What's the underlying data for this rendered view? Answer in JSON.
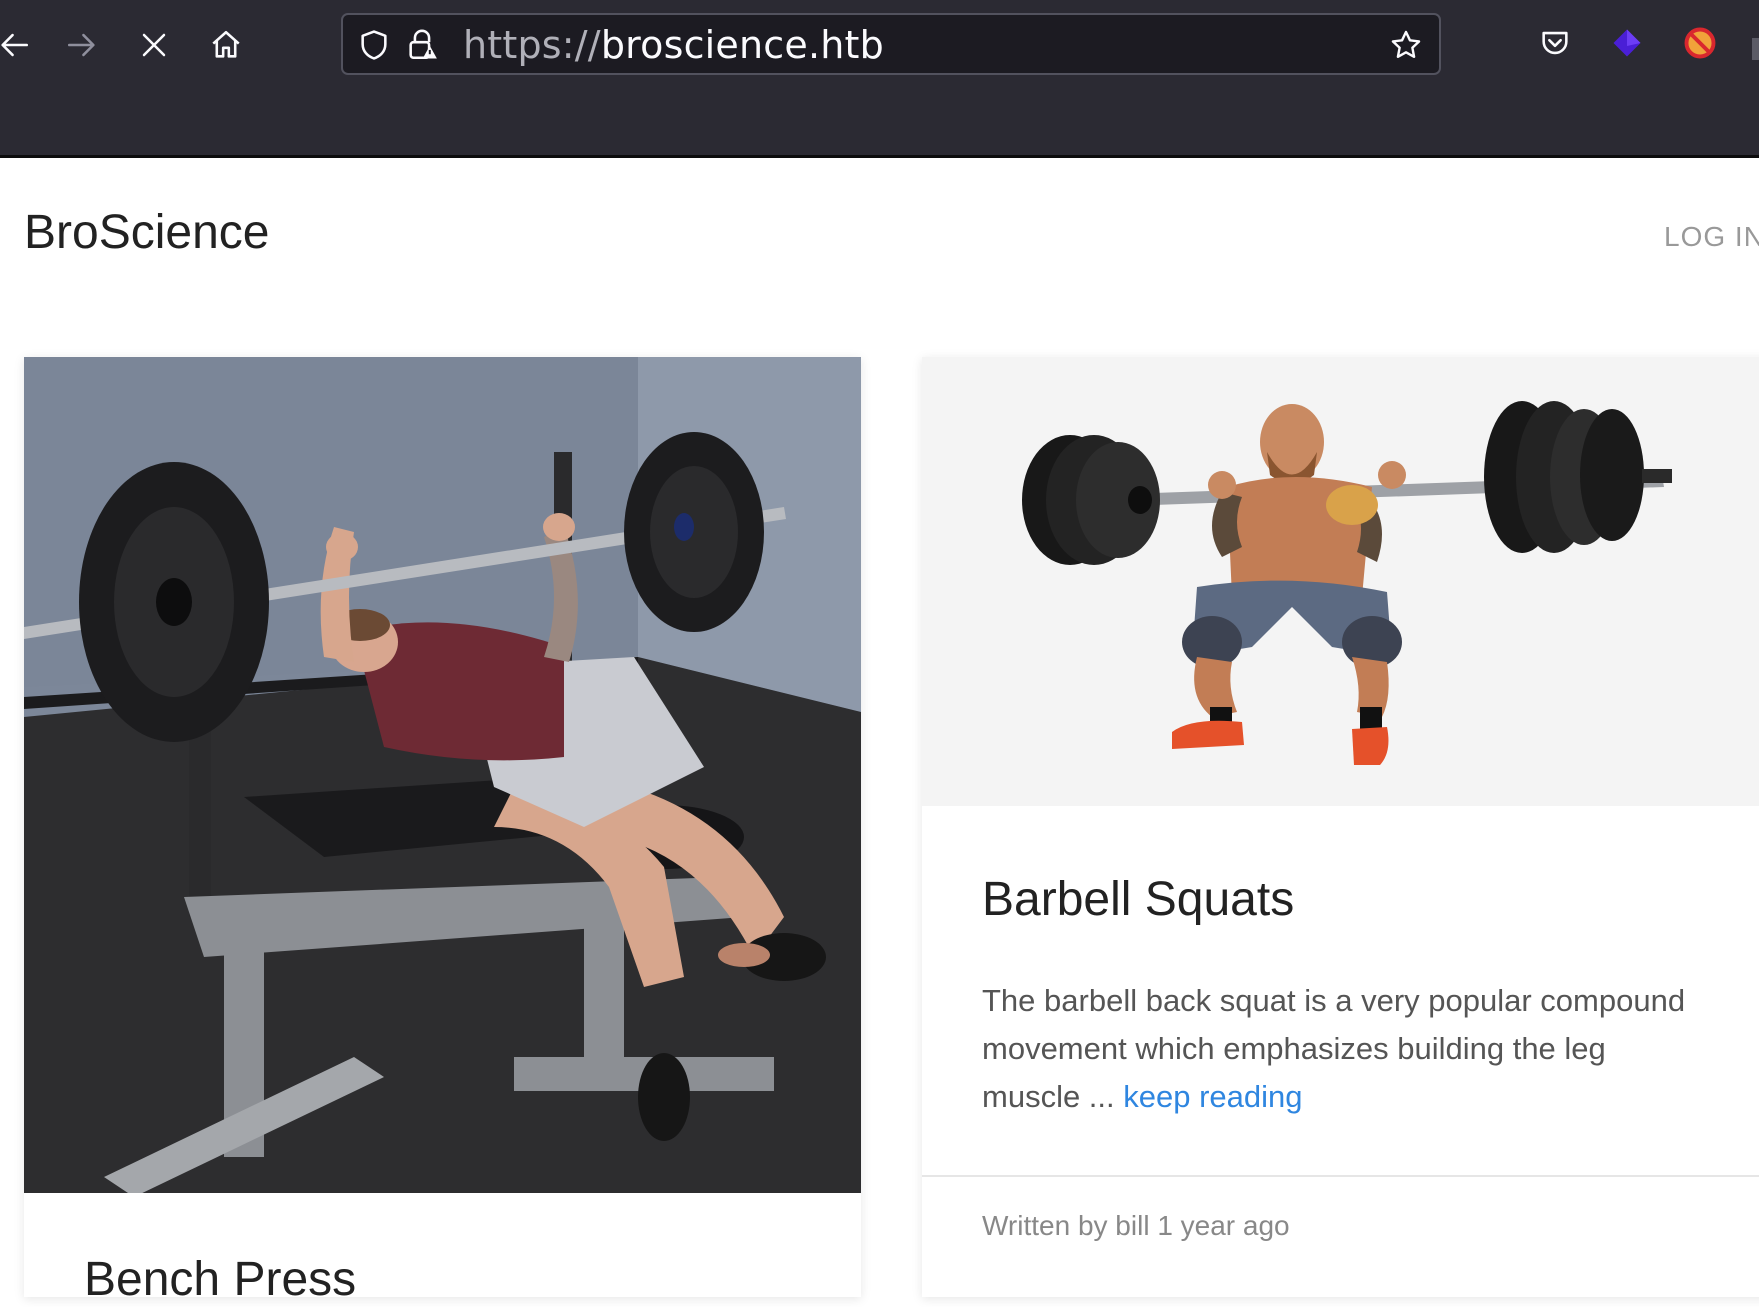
{
  "browser": {
    "url_protocol": "https://",
    "url_host": "broscience.htb",
    "icons": {
      "back": "arrow-left-icon",
      "forward": "arrow-right-icon",
      "stop": "close-icon",
      "home": "home-icon",
      "shield": "shield-icon",
      "lock": "lock-warning-icon",
      "bookmark": "star-icon",
      "pocket": "pocket-icon",
      "ext1": "purple-diamond-icon",
      "ext2": "blocked-extension-icon"
    }
  },
  "site": {
    "brand": "BroScience",
    "login_label": "LOG IN"
  },
  "posts": [
    {
      "title": "Bench Press",
      "image": "man-bench-pressing-barbell"
    },
    {
      "title": "Barbell Squats",
      "excerpt": "The barbell back squat is a very popular compound movement which emphasizes building the leg muscle ... ",
      "read_more": "keep reading",
      "meta": "Written by bill 1 year ago",
      "image": "man-squatting-barbell"
    }
  ],
  "colors": {
    "chrome_bg": "#2b2a33",
    "urlbar_bg": "#1c1b22",
    "link": "#2f86e0",
    "brand_text": "#222222"
  }
}
